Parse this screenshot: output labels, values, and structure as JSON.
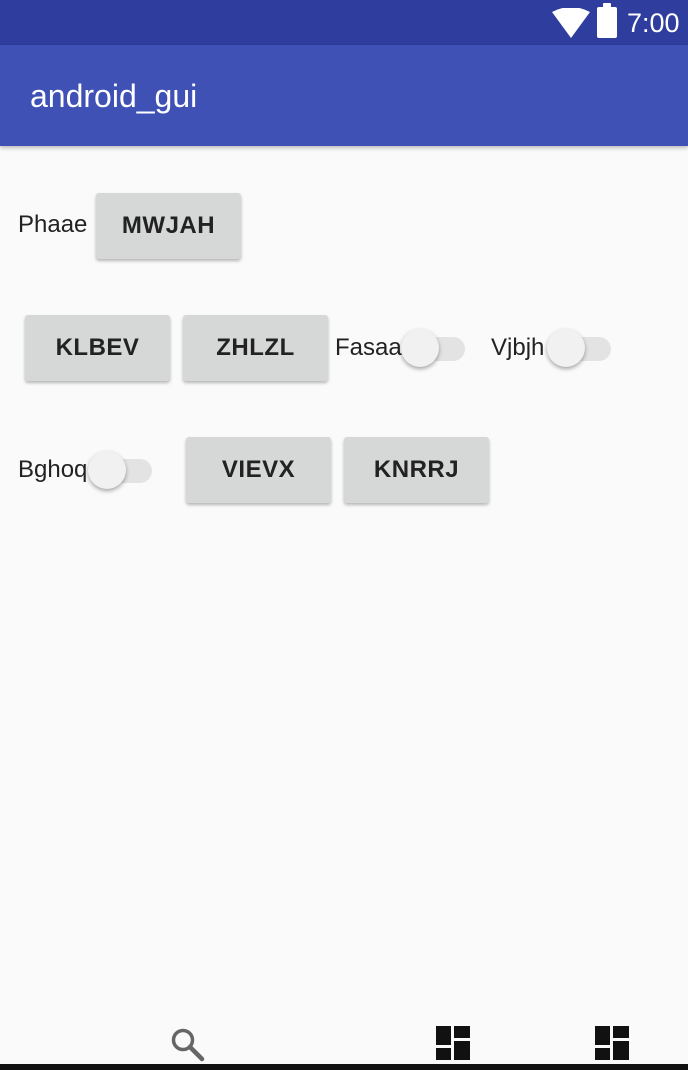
{
  "status_bar": {
    "time": "7:00",
    "icons": [
      "wifi-icon",
      "battery-icon"
    ]
  },
  "app_bar": {
    "title": "android_gui",
    "color": "#3f51b5",
    "status_color": "#2f3e9e"
  },
  "content": {
    "row1": {
      "label": "Phaae",
      "button": "MWJAH"
    },
    "row2": {
      "button1": "KLBEV",
      "button2": "ZHLZL",
      "switch1_label": "Fasaa",
      "switch1_on": false,
      "switch2_label": "Vjbjh",
      "switch2_on": false
    },
    "row3": {
      "switch_label": "Bghoq",
      "switch_on": false,
      "button1": "VIEVX",
      "button2": "KNRRJ"
    }
  },
  "bottom_nav": {
    "icons": [
      "search-icon",
      "dashboard-icon",
      "dashboard-icon"
    ]
  }
}
